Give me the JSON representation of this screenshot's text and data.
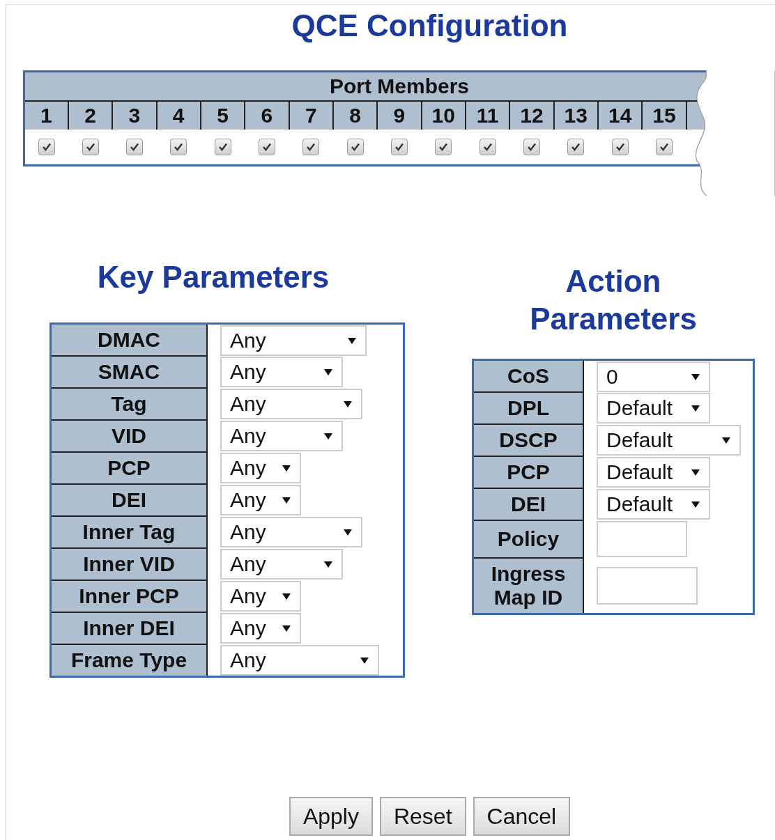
{
  "title": "QCE Configuration",
  "port_members": {
    "heading": "Port Members",
    "ports": [
      {
        "label": "1",
        "checked": true
      },
      {
        "label": "2",
        "checked": true
      },
      {
        "label": "3",
        "checked": true
      },
      {
        "label": "4",
        "checked": true
      },
      {
        "label": "5",
        "checked": true
      },
      {
        "label": "6",
        "checked": true
      },
      {
        "label": "7",
        "checked": true
      },
      {
        "label": "8",
        "checked": true
      },
      {
        "label": "9",
        "checked": true
      },
      {
        "label": "10",
        "checked": true
      },
      {
        "label": "11",
        "checked": true
      },
      {
        "label": "12",
        "checked": true
      },
      {
        "label": "13",
        "checked": true
      },
      {
        "label": "14",
        "checked": true
      },
      {
        "label": "15",
        "checked": true
      }
    ]
  },
  "key_parameters": {
    "heading": "Key Parameters",
    "rows": [
      {
        "label": "DMAC",
        "value": "Any"
      },
      {
        "label": "SMAC",
        "value": "Any"
      },
      {
        "label": "Tag",
        "value": "Any"
      },
      {
        "label": "VID",
        "value": "Any"
      },
      {
        "label": "PCP",
        "value": "Any"
      },
      {
        "label": "DEI",
        "value": "Any"
      },
      {
        "label": "Inner Tag",
        "value": "Any"
      },
      {
        "label": "Inner VID",
        "value": "Any"
      },
      {
        "label": "Inner PCP",
        "value": "Any"
      },
      {
        "label": "Inner DEI",
        "value": "Any"
      },
      {
        "label": "Frame Type",
        "value": "Any"
      }
    ]
  },
  "action_parameters": {
    "heading": "Action Parameters",
    "rows": [
      {
        "label": "CoS",
        "kind": "select",
        "value": "0"
      },
      {
        "label": "DPL",
        "kind": "select",
        "value": "Default"
      },
      {
        "label": "DSCP",
        "kind": "select",
        "value": "Default"
      },
      {
        "label": "PCP",
        "kind": "select",
        "value": "Default"
      },
      {
        "label": "DEI",
        "kind": "select",
        "value": "Default"
      },
      {
        "label": "Policy",
        "kind": "text"
      },
      {
        "label": "Ingress Map ID",
        "kind": "text"
      }
    ]
  },
  "buttons": [
    "Apply",
    "Reset",
    "Cancel"
  ]
}
